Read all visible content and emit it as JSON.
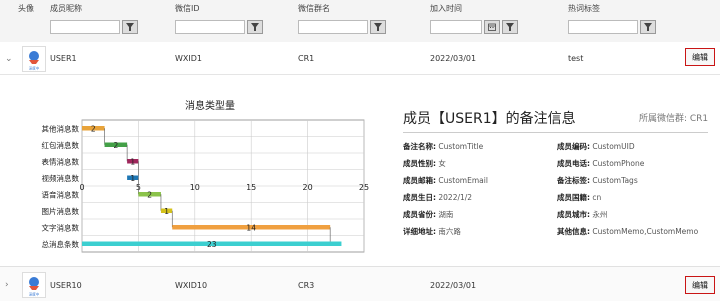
{
  "columns": {
    "avatar": "头像",
    "nickname": "成员昵称",
    "wechat_id": "微信ID",
    "group_name": "微信群名",
    "join_time": "加入时间",
    "hot_tags": "热词标签"
  },
  "rows": [
    {
      "name": "USER1",
      "wechat_id": "WXID1",
      "group": "CR1",
      "date": "2022/03/01",
      "tag": "test",
      "edit": "编辑",
      "expanded": true
    },
    {
      "name": "USER10",
      "wechat_id": "WXID10",
      "group": "CR3",
      "date": "2022/03/01",
      "tag": "",
      "edit": "编辑",
      "expanded": false
    }
  ],
  "chart_data": {
    "type": "bar",
    "title": "消息类型量",
    "orientation": "waterfall-horizontal",
    "categories": [
      "其他消息数",
      "红包消息数",
      "表情消息数",
      "视频消息数",
      "语音消息数",
      "图片消息数",
      "文字消息数",
      "总消息条数"
    ],
    "starts": [
      0,
      2,
      4,
      4,
      5,
      7,
      8,
      0
    ],
    "values": [
      2,
      2,
      1,
      1,
      2,
      1,
      14,
      23
    ],
    "colors": [
      "#e8a33a",
      "#43a047",
      "#a0275c",
      "#1f77b4",
      "#8bc34a",
      "#d4c21c",
      "#f0a040",
      "#3ccfd0"
    ],
    "xlim": [
      0,
      25
    ],
    "xticks": [
      0,
      5,
      10,
      15,
      20,
      25
    ],
    "grid": true
  },
  "info": {
    "title": "成员【USER1】的备注信息",
    "group_label": "所属微信群: CR1",
    "fields": [
      {
        "k": "备注名称:",
        "v": "CustomTitle"
      },
      {
        "k": "成员编码:",
        "v": "CustomUID"
      },
      {
        "k": "成员性别:",
        "v": "女"
      },
      {
        "k": "成员电话:",
        "v": "CustomPhone"
      },
      {
        "k": "成员邮箱:",
        "v": "CustomEmail"
      },
      {
        "k": "备注标签:",
        "v": "CustomTags"
      },
      {
        "k": "成员生日:",
        "v": "2022/1/2"
      },
      {
        "k": "成员国籍:",
        "v": "cn"
      },
      {
        "k": "成员省份:",
        "v": "湖南"
      },
      {
        "k": "成员城市:",
        "v": "永州"
      },
      {
        "k": "详细地址:",
        "v": "南六路"
      },
      {
        "k": "其他信息:",
        "v": "CustomMemo,CustomMemo"
      }
    ]
  },
  "avatar_text": "深度中"
}
